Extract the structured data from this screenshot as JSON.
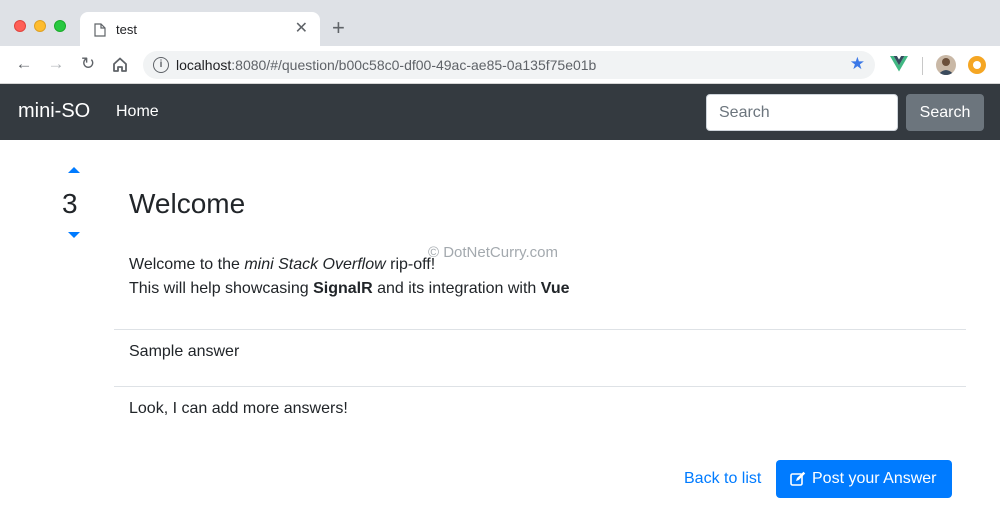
{
  "browser": {
    "tab_title": "test",
    "tab_close": "✕",
    "new_tab": "+",
    "url_host": "localhost",
    "url_rest": ":8080/#/question/b00c58c0-df00-49ac-ae85-0a135f75e01b"
  },
  "navbar": {
    "brand": "mini-SO",
    "home": "Home",
    "search_placeholder": "Search",
    "search_button": "Search"
  },
  "question": {
    "votes": "3",
    "title": "Welcome",
    "body_line1_pre": "Welcome to the ",
    "body_line1_em": "mini Stack Overflow",
    "body_line1_post": " rip-off!",
    "body_line2_pre": "This will help showcasing ",
    "body_line2_b1": "SignalR",
    "body_line2_mid": " and its integration with ",
    "body_line2_b2": "Vue"
  },
  "answers": [
    {
      "text": "Sample answer"
    },
    {
      "text": "Look, I can add more answers!"
    }
  ],
  "watermark": "© DotNetCurry.com",
  "actions": {
    "back": "Back to list",
    "post": "Post your Answer"
  },
  "colors": {
    "primary": "#007bff",
    "navbar": "#343a40",
    "secondary": "#6c757d"
  }
}
